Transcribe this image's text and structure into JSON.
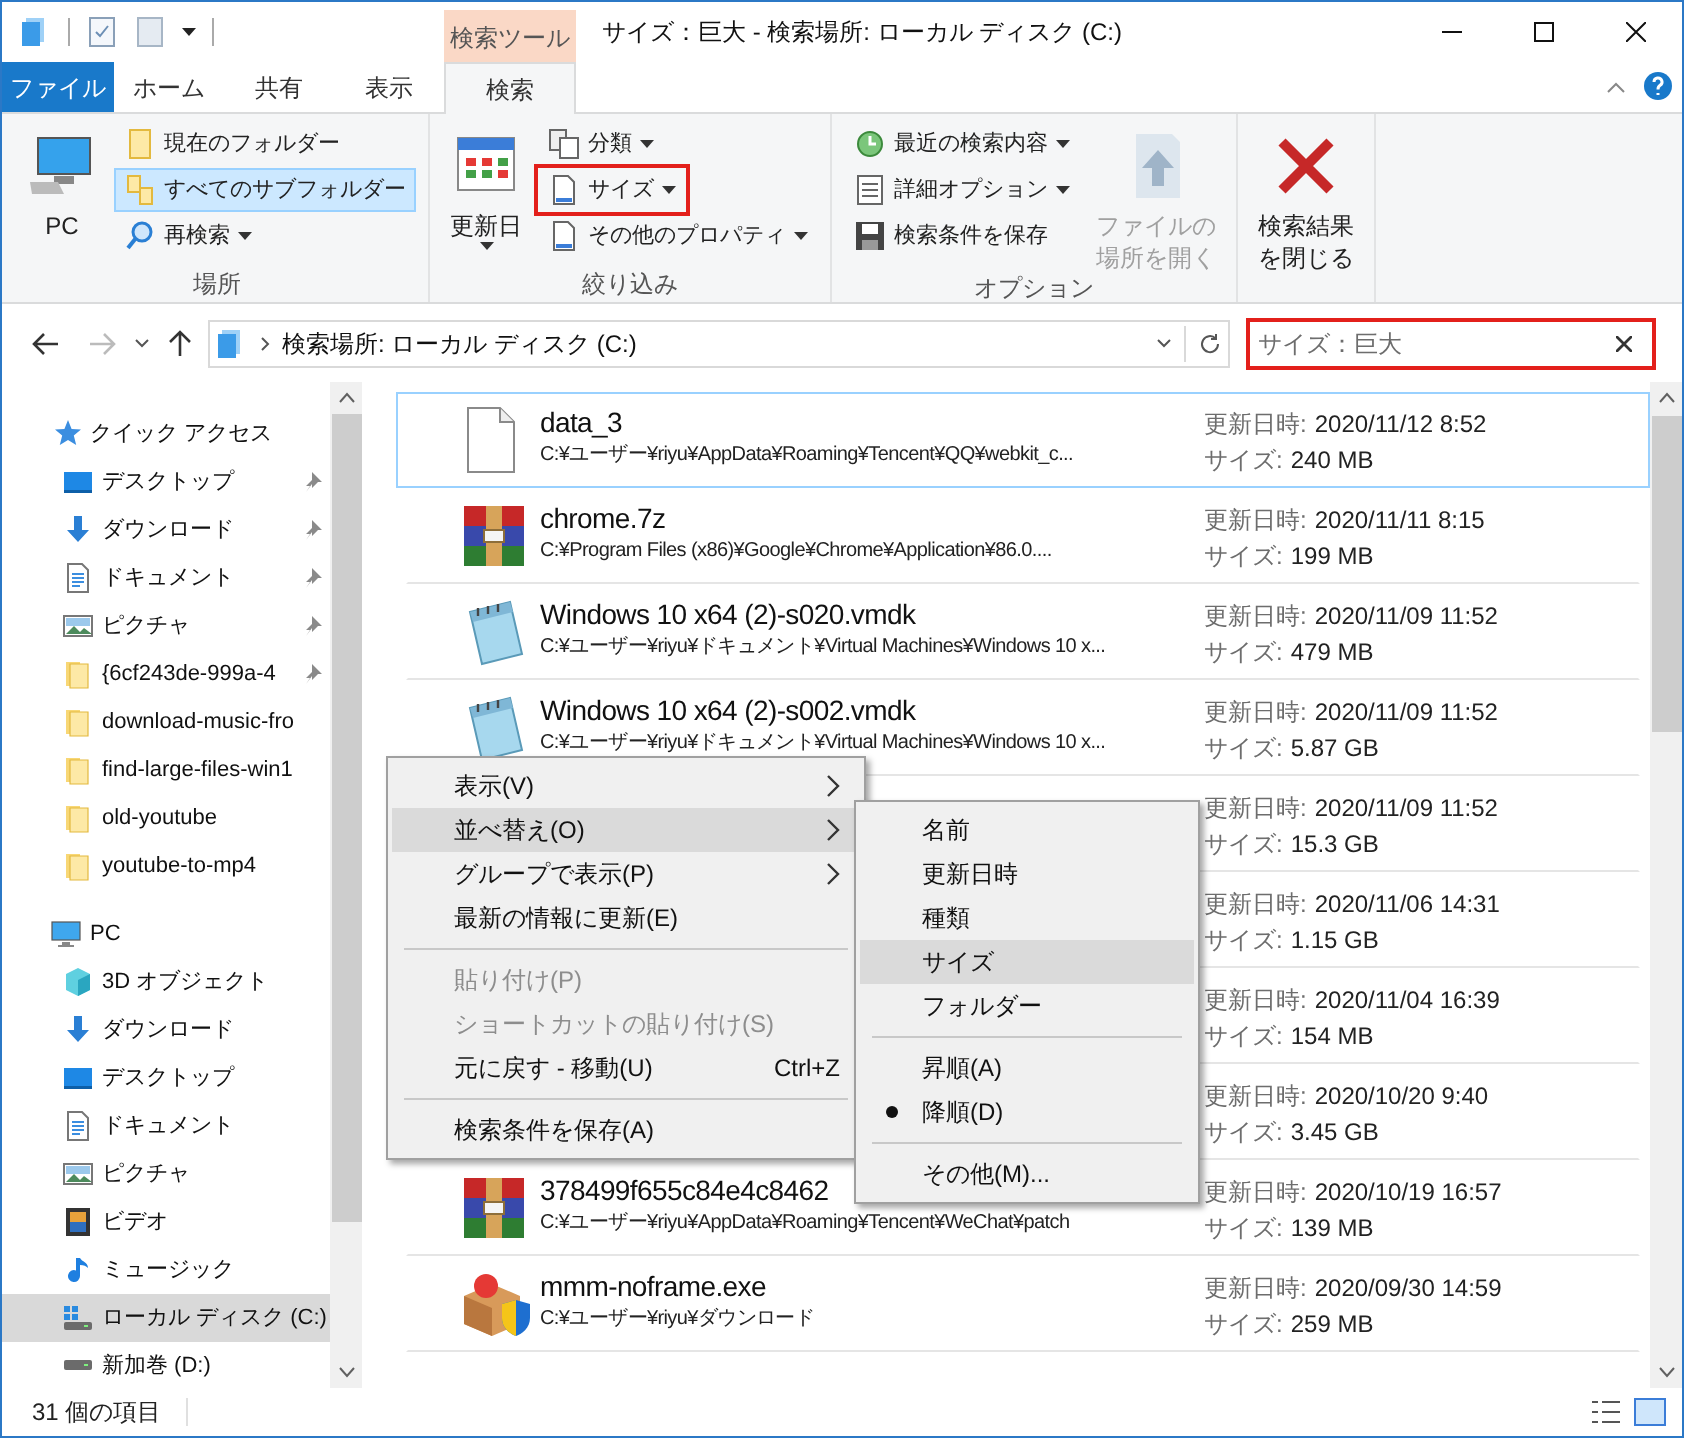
{
  "window": {
    "title": "サイズ：巨大 - 検索場所: ローカル ディスク (C:)",
    "context_tab": "検索ツール"
  },
  "ribbon_tabs": [
    {
      "label": "ファイル",
      "kind": "file",
      "selected": false
    },
    {
      "label": "ホーム",
      "kind": "tab",
      "selected": false
    },
    {
      "label": "共有",
      "kind": "tab",
      "selected": false
    },
    {
      "label": "表示",
      "kind": "tab",
      "selected": false
    },
    {
      "label": "検索",
      "kind": "tab",
      "selected": true
    }
  ],
  "ribbon_groups": [
    {
      "label": "場所",
      "buttons": [
        {
          "kind": "large",
          "lines": [
            "PC"
          ],
          "dropdown": false,
          "selected": false,
          "disabled": false,
          "framed": false
        },
        {
          "kind": "small",
          "lines": [
            "現在のフォルダー"
          ],
          "dropdown": false,
          "selected": false,
          "disabled": false,
          "framed": false
        },
        {
          "kind": "small",
          "lines": [
            "すべてのサブフォルダー"
          ],
          "dropdown": false,
          "selected": true,
          "disabled": false,
          "framed": false
        },
        {
          "kind": "small",
          "lines": [
            "再検索"
          ],
          "dropdown": true,
          "selected": false,
          "disabled": false,
          "framed": false
        }
      ]
    },
    {
      "label": "絞り込み",
      "buttons": [
        {
          "kind": "large",
          "lines": [
            "更新日"
          ],
          "dropdown": true,
          "selected": false,
          "disabled": false,
          "framed": false
        },
        {
          "kind": "small",
          "lines": [
            "分類"
          ],
          "dropdown": true,
          "selected": false,
          "disabled": false,
          "framed": false
        },
        {
          "kind": "small",
          "lines": [
            "サイズ"
          ],
          "dropdown": true,
          "selected": false,
          "disabled": false,
          "framed": true
        },
        {
          "kind": "small",
          "lines": [
            "その他のプロパティ"
          ],
          "dropdown": true,
          "selected": false,
          "disabled": false,
          "framed": false
        }
      ]
    },
    {
      "label": "オプション",
      "buttons": [
        {
          "kind": "small",
          "lines": [
            "最近の検索内容"
          ],
          "dropdown": true,
          "selected": false,
          "disabled": false,
          "framed": false
        },
        {
          "kind": "small",
          "lines": [
            "詳細オプション"
          ],
          "dropdown": true,
          "selected": false,
          "disabled": false,
          "framed": false
        },
        {
          "kind": "small",
          "lines": [
            "検索条件を保存"
          ],
          "dropdown": false,
          "selected": false,
          "disabled": false,
          "framed": false
        },
        {
          "kind": "large",
          "lines": [
            "ファイルの",
            "場所を開く"
          ],
          "dropdown": false,
          "selected": false,
          "disabled": true,
          "framed": false
        }
      ]
    },
    {
      "buttons": [
        {
          "kind": "large",
          "lines": [
            "検索結果",
            "を閉じる"
          ],
          "dropdown": false,
          "selected": false,
          "disabled": false,
          "framed": false
        }
      ]
    }
  ],
  "address": {
    "path": "検索場所: ローカル ディスク (C:)"
  },
  "search": {
    "value": "サイズ：巨大",
    "framed": true
  },
  "navigation": [
    {
      "label": "クイック アクセス",
      "kind": "star",
      "selected": false,
      "children": [
        {
          "label": "デスクトップ",
          "kind": "desktop",
          "pinned": true,
          "selected": false
        },
        {
          "label": "ダウンロード",
          "kind": "download",
          "pinned": true,
          "selected": false
        },
        {
          "label": "ドキュメント",
          "kind": "document",
          "pinned": true,
          "selected": false
        },
        {
          "label": "ピクチャ",
          "kind": "picture",
          "pinned": true,
          "selected": false
        },
        {
          "label": "{6cf243de-999a-4",
          "kind": "folder",
          "pinned": true,
          "selected": false
        },
        {
          "label": "download-music-fro",
          "kind": "folder",
          "pinned": false,
          "selected": false
        },
        {
          "label": "find-large-files-win1",
          "kind": "folder",
          "pinned": false,
          "selected": false
        },
        {
          "label": "old-youtube",
          "kind": "folder",
          "pinned": false,
          "selected": false
        },
        {
          "label": "youtube-to-mp4",
          "kind": "folder",
          "pinned": false,
          "selected": false
        }
      ]
    },
    {
      "label": "PC",
      "kind": "pc",
      "selected": false,
      "children": [
        {
          "label": "3D オブジェクト",
          "kind": "cube",
          "pinned": false,
          "selected": false
        },
        {
          "label": "ダウンロード",
          "kind": "download",
          "pinned": false,
          "selected": false
        },
        {
          "label": "デスクトップ",
          "kind": "desktop",
          "pinned": false,
          "selected": false
        },
        {
          "label": "ドキュメント",
          "kind": "document",
          "pinned": false,
          "selected": false
        },
        {
          "label": "ピクチャ",
          "kind": "picture",
          "pinned": false,
          "selected": false
        },
        {
          "label": "ビデオ",
          "kind": "video",
          "pinned": false,
          "selected": false
        },
        {
          "label": "ミュージック",
          "kind": "music",
          "pinned": false,
          "selected": false
        },
        {
          "label": "ローカル ディスク (C:)",
          "kind": "drive-c",
          "pinned": false,
          "selected": true
        },
        {
          "label": "新加巻 (D:)",
          "kind": "drive",
          "pinned": false,
          "selected": false
        }
      ]
    }
  ],
  "results": [
    {
      "name": "data_3",
      "path": "C:¥ユーザー¥riyu¥AppData¥Roaming¥Tencent¥QQ¥webkit_c...",
      "kind": "file",
      "date_label": "更新日時:",
      "date": "2020/11/12 8:52",
      "size_label": "サイズ:",
      "size": "240 MB",
      "selected": true
    },
    {
      "name": "chrome.7z",
      "path": "C:¥Program Files (x86)¥Google¥Chrome¥Application¥86.0....",
      "kind": "archive",
      "date_label": "更新日時:",
      "date": "2020/11/11 8:15",
      "size_label": "サイズ:",
      "size": "199 MB",
      "selected": false
    },
    {
      "name": "Windows 10 x64 (2)-s020.vmdk",
      "path": "C:¥ユーザー¥riyu¥ドキュメント¥Virtual Machines¥Windows 10 x...",
      "kind": "notepad",
      "date_label": "更新日時:",
      "date": "2020/11/09 11:52",
      "size_label": "サイズ:",
      "size": "479 MB",
      "selected": false
    },
    {
      "name": "Windows 10 x64 (2)-s002.vmdk",
      "path": "C:¥ユーザー¥riyu¥ドキュメント¥Virtual Machines¥Windows 10 x...",
      "kind": "notepad",
      "date_label": "更新日時:",
      "date": "2020/11/09 11:52",
      "size_label": "サイズ:",
      "size": "5.87 GB",
      "selected": false
    },
    {
      "date_label": "更新日時:",
      "date": "2020/11/09 11:52",
      "size_label": "サイズ:",
      "size": "15.3 GB",
      "selected": false
    },
    {
      "date_label": "更新日時:",
      "date": "2020/11/06 14:31",
      "size_label": "サイズ:",
      "size": "1.15 GB",
      "selected": false
    },
    {
      "date_label": "更新日時:",
      "date": "2020/11/04 16:39",
      "size_label": "サイズ:",
      "size": "154 MB",
      "selected": false
    },
    {
      "date_label": "更新日時:",
      "date": "2020/10/20 9:40",
      "size_label": "サイズ:",
      "size": "3.45 GB",
      "selected": false
    },
    {
      "name": "378499f655c84e4c8462",
      "path": "C:¥ユーザー¥riyu¥AppData¥Roaming¥Tencent¥WeChat¥patch",
      "kind": "archive",
      "date_label": "更新日時:",
      "date": "2020/10/19 16:57",
      "size_label": "サイズ:",
      "size": "139 MB",
      "selected": false
    },
    {
      "name": "mmm-noframe.exe",
      "path": "C:¥ユーザー¥riyu¥ダウンロード",
      "kind": "installer",
      "date_label": "更新日時:",
      "date": "2020/09/30 14:59",
      "size_label": "サイズ:",
      "size": "259 MB",
      "selected": false
    }
  ],
  "context_menu": [
    {
      "kind": "item",
      "label": "表示(V)",
      "submenu": true,
      "selected": false,
      "disabled": false
    },
    {
      "kind": "item",
      "label": "並べ替え(O)",
      "submenu": true,
      "selected": true,
      "disabled": false
    },
    {
      "kind": "item",
      "label": "グループで表示(P)",
      "submenu": true,
      "selected": false,
      "disabled": false
    },
    {
      "kind": "item",
      "label": "最新の情報に更新(E)",
      "submenu": false,
      "selected": false,
      "disabled": false
    },
    {
      "kind": "separator"
    },
    {
      "kind": "item",
      "label": "貼り付け(P)",
      "submenu": false,
      "selected": false,
      "disabled": true
    },
    {
      "kind": "item",
      "label": "ショートカットの貼り付け(S)",
      "submenu": false,
      "selected": false,
      "disabled": true
    },
    {
      "kind": "item",
      "label": "元に戻す - 移動(U)",
      "shortcut": "Ctrl+Z",
      "submenu": false,
      "selected": false,
      "disabled": false
    },
    {
      "kind": "separator"
    },
    {
      "kind": "item",
      "label": "検索条件を保存(A)",
      "submenu": false,
      "selected": false,
      "disabled": false
    }
  ],
  "sort_submenu": [
    {
      "kind": "item",
      "label": "名前",
      "selected": false,
      "checked": false
    },
    {
      "kind": "item",
      "label": "更新日時",
      "selected": false,
      "checked": false
    },
    {
      "kind": "item",
      "label": "種類",
      "selected": false,
      "checked": false
    },
    {
      "kind": "item",
      "label": "サイズ",
      "selected": true,
      "checked": false
    },
    {
      "kind": "item",
      "label": "フォルダー",
      "selected": false,
      "checked": false
    },
    {
      "kind": "separator"
    },
    {
      "kind": "item",
      "label": "昇順(A)",
      "selected": false,
      "checked": false
    },
    {
      "kind": "item",
      "label": "降順(D)",
      "selected": false,
      "checked": true
    },
    {
      "kind": "separator"
    },
    {
      "kind": "item",
      "label": "その他(M)...",
      "selected": false,
      "checked": false
    }
  ],
  "status_bar": {
    "count": "31 個の項目"
  }
}
